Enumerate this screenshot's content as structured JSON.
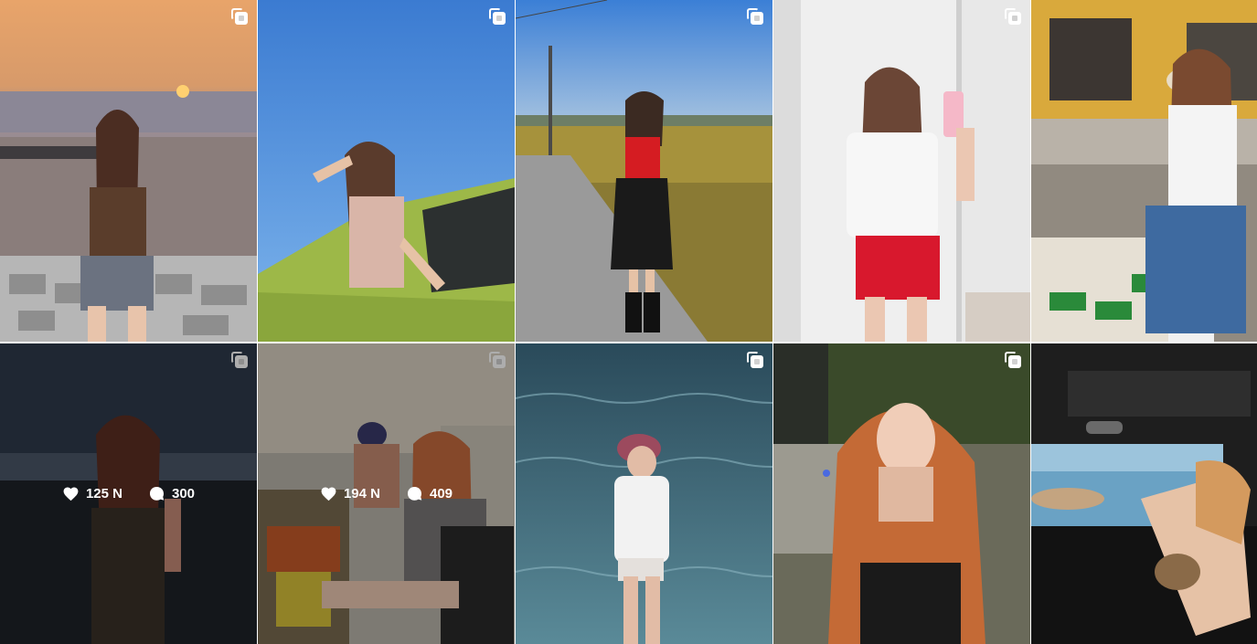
{
  "grid": {
    "posts": [
      {
        "id": "post-1",
        "multi": true,
        "alt": "sunset seaside portrait"
      },
      {
        "id": "post-2",
        "multi": true,
        "alt": "posing by green car"
      },
      {
        "id": "post-3",
        "multi": true,
        "alt": "rice field road"
      },
      {
        "id": "post-4",
        "multi": true,
        "alt": "mirror selfie"
      },
      {
        "id": "post-5",
        "multi": true,
        "alt": "street vendor"
      },
      {
        "id": "post-6",
        "multi": true,
        "hover": true,
        "likes": "125 N",
        "comments": "300"
      },
      {
        "id": "post-7",
        "multi": true,
        "hover": true,
        "likes": "194 N",
        "comments": "409"
      },
      {
        "id": "post-8",
        "multi": true,
        "alt": "ocean wading"
      },
      {
        "id": "post-9",
        "multi": true,
        "alt": "night portrait"
      },
      {
        "id": "post-10",
        "multi": false,
        "alt": "car window"
      }
    ],
    "icons": {
      "multi": "carousel-icon",
      "like": "heart-icon",
      "comment": "comment-icon"
    }
  }
}
